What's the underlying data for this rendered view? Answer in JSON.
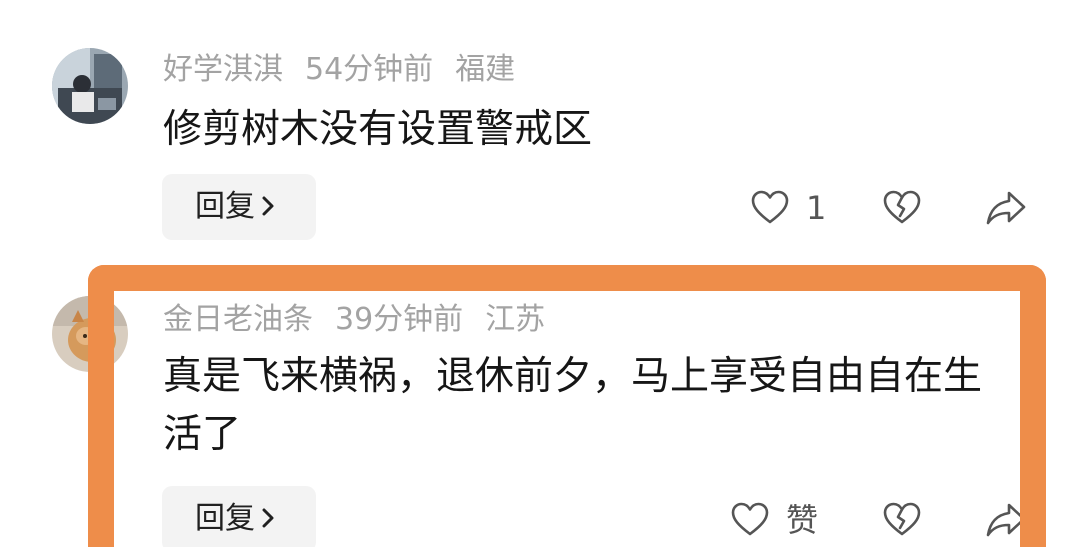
{
  "comments": [
    {
      "username": "好学淇淇",
      "time": "54分钟前",
      "location": "福建",
      "text": "修剪树木没有设置警戒区",
      "reply_label": "回复",
      "like_count": "1"
    },
    {
      "username": "金日老油条",
      "time": "39分钟前",
      "location": "江苏",
      "text": "真是飞来横祸，退休前夕，马上享受自由自在生活了",
      "reply_label": "回复",
      "like_label": "赞"
    }
  ],
  "icons": {
    "like": "heart-icon",
    "dislike": "broken-heart-icon",
    "share": "share-arrow-icon",
    "reply_chevron": "chevron-right-icon"
  },
  "colors": {
    "highlight_border": "#ee8d4a",
    "meta_text": "#a3a3a3",
    "reply_bg": "#f3f3f3"
  }
}
